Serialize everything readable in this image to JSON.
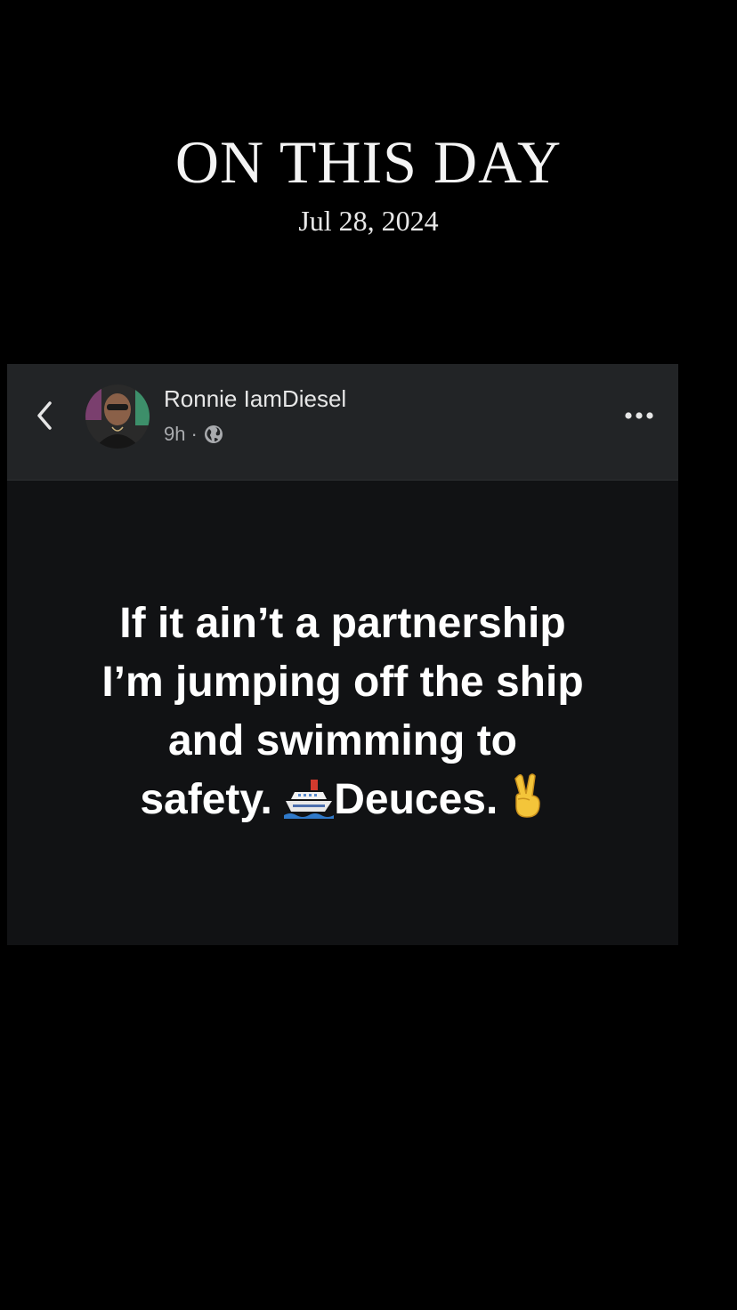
{
  "memory": {
    "title": "ON THIS DAY",
    "date": "Jul 28, 2024"
  },
  "post": {
    "author_name": "Ronnie IamDiesel",
    "time_ago": "9h",
    "separator": "·",
    "audience_icon": "globe-icon",
    "back_icon": "chevron-left-icon",
    "more_icon": "more-horizontal-icon",
    "text_lines": [
      "If it ain’t a partnership",
      "I’m jumping off the ship",
      "and swimming to",
      "safety. ",
      "Deuces. "
    ],
    "emojis": [
      "ship-emoji",
      "victory-hand-emoji"
    ]
  },
  "colors": {
    "background": "#000000",
    "header_bg": "#222426",
    "body_bg": "#111214",
    "text": "#ffffff",
    "meta_text": "#a9abae"
  }
}
